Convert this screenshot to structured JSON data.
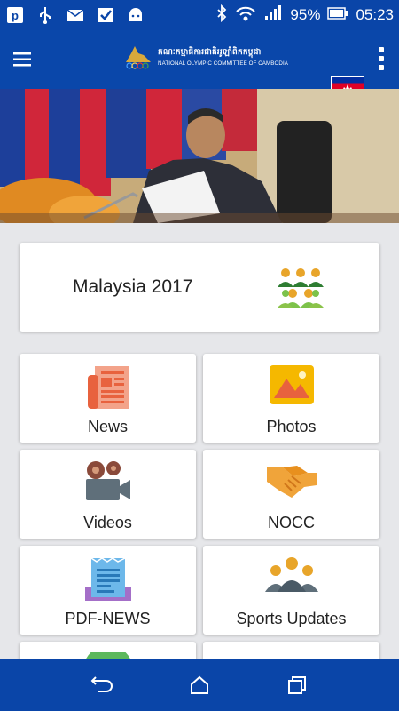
{
  "status_bar": {
    "battery": "95%",
    "time": "05:23",
    "icons": [
      "p-app-icon",
      "usb-icon",
      "mail-icon",
      "check-icon",
      "android-icon",
      "bluetooth-icon",
      "wifi-icon",
      "signal-icon",
      "battery-icon"
    ]
  },
  "app_bar": {
    "logo_khmer": "គណៈកម្មាធិការជាតិអូឡាំពិកកម្ពុជា",
    "logo_english": "NATIONAL OLYMPIC COMMITTEE OF CAMBODIA",
    "menu_icon": "hamburger-menu-icon",
    "flag_icon": "cambodia-flag-icon",
    "overflow_icon": "more-vertical-icon"
  },
  "hero": {
    "slides": 4,
    "active_slide": 0
  },
  "featured": {
    "label": "Malaysia 2017",
    "icon": "group-people-icon"
  },
  "tiles": [
    {
      "label": "News",
      "icon": "newspaper-icon"
    },
    {
      "label": "Photos",
      "icon": "photo-icon"
    },
    {
      "label": "Videos",
      "icon": "video-camera-icon"
    },
    {
      "label": "NOCC",
      "icon": "handshake-icon"
    },
    {
      "label": "PDF-NEWS",
      "icon": "pdf-document-icon"
    },
    {
      "label": "Sports Updates",
      "icon": "team-icon"
    }
  ],
  "colors": {
    "primary": "#0a47aa",
    "background": "#e6e7ea",
    "card": "#ffffff"
  }
}
